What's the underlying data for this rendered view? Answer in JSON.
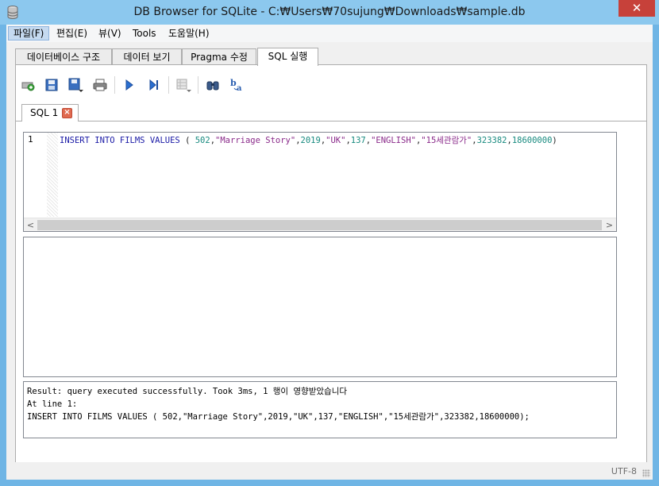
{
  "window": {
    "title": "DB Browser for SQLite - C:₩Users₩70sujung₩Downloads₩sample.db",
    "close_glyph": "✕"
  },
  "menu": [
    {
      "label": "파일(F)"
    },
    {
      "label": "편집(E)"
    },
    {
      "label": "뷰(V)"
    },
    {
      "label": "Tools"
    },
    {
      "label": "도움말(H)"
    }
  ],
  "tabs": [
    {
      "label": "데이터베이스 구조"
    },
    {
      "label": "데이터 보기"
    },
    {
      "label": "Pragma 수정"
    },
    {
      "label": "SQL 실행"
    }
  ],
  "toolbar": {
    "icons": [
      "open-tab-icon",
      "open-sql-icon",
      "save-sql-icon",
      "print-icon",
      "execute-all-icon",
      "execute-line-icon",
      "save-results-icon",
      "find-icon",
      "find-replace-icon"
    ]
  },
  "editor_tab": {
    "label": "SQL 1",
    "close_glyph": "×"
  },
  "editor": {
    "line_number": "1",
    "tokens": {
      "k1": "INSERT",
      "k2": "INTO",
      "k3": "FILMS",
      "k4": "VALUES",
      "p1": " ( ",
      "n1": "502",
      "c1": ",",
      "s1": "\"Marriage Story\"",
      "c2": ",",
      "n2": "2019",
      "c3": ",",
      "s2": "\"UK\"",
      "c4": ",",
      "n3": "137",
      "c5": ",",
      "s3": "\"ENGLISH\"",
      "c6": ",",
      "s4": "\"15세관람가\"",
      "c7": ",",
      "n4": "323382",
      "c8": ",",
      "n5": "18600000",
      "p2": ")"
    },
    "scroll_left": "<",
    "scroll_right": ">"
  },
  "messages": {
    "line1": "Result: query executed successfully. Took 3ms, 1 행이 영향받았습니다",
    "line2": "At line 1:",
    "line3": "INSERT INTO FILMS VALUES ( 502,\"Marriage Story\",2019,\"UK\",137,\"ENGLISH\",\"15세관람가\",323382,18600000);"
  },
  "status": {
    "encoding": "UTF-8"
  }
}
